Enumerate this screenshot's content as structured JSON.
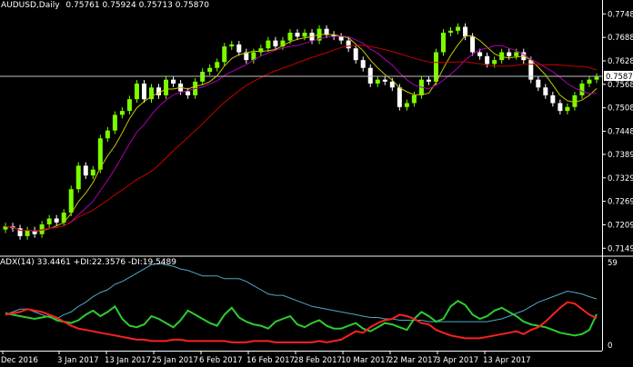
{
  "main": {
    "header": {
      "symbol_label": "AUDUSD,Daily",
      "ohlc": [
        "0.75761",
        "0.75924",
        "0.75713",
        "0.75870"
      ]
    },
    "current_price_label": "0.75870",
    "price_ticks": [
      "0.77480",
      "0.76880",
      "0.76280",
      "0.75680",
      "0.75080",
      "0.74480",
      "0.73890",
      "0.73290",
      "0.72690",
      "0.72090",
      "0.71490"
    ]
  },
  "indicator": {
    "header": "ADX(14) 33.4461 +DI:22.3576 -DI:19.5489",
    "top_tick": "59",
    "bottom_tick": "0"
  },
  "x_axis": {
    "date_labels": [
      "Dec 2016",
      "3 Jan 2017",
      "13 Jan 2017",
      "25 Jan 2017",
      "6 Feb 2017",
      "16 Feb 2017",
      "28 Feb 2017",
      "10 Mar 2017",
      "22 Mar 2017",
      "3 Apr 2017",
      "13 Apr 2017"
    ]
  },
  "colors": {
    "background": "#000000",
    "bull_candle": "#7CFC00",
    "bear_candle": "#FFFFFF",
    "ma_fast": "#C8C800",
    "ma_mid": "#B000B0",
    "ma_slow": "#C80000",
    "adx": "#4FA8C8",
    "plus_di": "#2ECC2E",
    "minus_di": "#FF2020",
    "grid_text": "#FFFFFF",
    "current_price_line": "#C0C0C0"
  },
  "chart_data": [
    {
      "type": "candlestick",
      "title": "AUDUSD,Daily",
      "ylim": [
        0.7145,
        0.7765
      ],
      "dates": [
        "2016-12-22",
        "2016-12-23",
        "2016-12-26",
        "2016-12-27",
        "2016-12-28",
        "2016-12-29",
        "2016-12-30",
        "2017-01-02",
        "2017-01-03",
        "2017-01-04",
        "2017-01-05",
        "2017-01-06",
        "2017-01-09",
        "2017-01-10",
        "2017-01-11",
        "2017-01-12",
        "2017-01-13",
        "2017-01-16",
        "2017-01-17",
        "2017-01-18",
        "2017-01-19",
        "2017-01-20",
        "2017-01-23",
        "2017-01-24",
        "2017-01-25",
        "2017-01-26",
        "2017-01-27",
        "2017-01-30",
        "2017-01-31",
        "2017-02-01",
        "2017-02-02",
        "2017-02-03",
        "2017-02-06",
        "2017-02-07",
        "2017-02-08",
        "2017-02-09",
        "2017-02-10",
        "2017-02-13",
        "2017-02-14",
        "2017-02-15",
        "2017-02-16",
        "2017-02-17",
        "2017-02-20",
        "2017-02-21",
        "2017-02-22",
        "2017-02-23",
        "2017-02-24",
        "2017-02-27",
        "2017-02-28",
        "2017-03-01",
        "2017-03-02",
        "2017-03-03",
        "2017-03-06",
        "2017-03-07",
        "2017-03-08",
        "2017-03-09",
        "2017-03-10",
        "2017-03-13",
        "2017-03-14",
        "2017-03-15",
        "2017-03-16",
        "2017-03-17",
        "2017-03-20",
        "2017-03-21",
        "2017-03-22",
        "2017-03-23",
        "2017-03-24",
        "2017-03-27",
        "2017-03-28",
        "2017-03-29",
        "2017-03-30",
        "2017-03-31",
        "2017-04-03",
        "2017-04-04",
        "2017-04-05",
        "2017-04-06",
        "2017-04-07",
        "2017-04-10",
        "2017-04-11",
        "2017-04-12",
        "2017-04-13",
        "2017-04-14"
      ],
      "closes": [
        0.7205,
        0.72,
        0.718,
        0.7195,
        0.7185,
        0.721,
        0.7225,
        0.7215,
        0.724,
        0.73,
        0.736,
        0.7335,
        0.735,
        0.743,
        0.745,
        0.749,
        0.75,
        0.753,
        0.757,
        0.753,
        0.756,
        0.754,
        0.758,
        0.757,
        0.755,
        0.754,
        0.7575,
        0.76,
        0.761,
        0.7625,
        0.7665,
        0.767,
        0.765,
        0.763,
        0.765,
        0.766,
        0.768,
        0.7665,
        0.768,
        0.77,
        0.769,
        0.77,
        0.768,
        0.771,
        0.7695,
        0.769,
        0.768,
        0.766,
        0.763,
        0.761,
        0.757,
        0.758,
        0.7575,
        0.756,
        0.751,
        0.752,
        0.754,
        0.758,
        0.7575,
        0.765,
        0.77,
        0.7705,
        0.7715,
        0.769,
        0.765,
        0.764,
        0.762,
        0.763,
        0.765,
        0.764,
        0.765,
        0.763,
        0.758,
        0.756,
        0.754,
        0.752,
        0.75,
        0.751,
        0.754,
        0.757,
        0.758,
        0.7587
      ],
      "ma_fast_last": 0.758,
      "ma_mid_last": 0.7568,
      "ma_slow_last": 0.7592
    },
    {
      "type": "line",
      "title": "ADX(14) 33.4461 +DI:22.3576 -DI:19.5489",
      "ylim": [
        0,
        59
      ],
      "series": [
        {
          "name": "ADX",
          "values": [
            22,
            24,
            26,
            26,
            24,
            22,
            20,
            19,
            22,
            24,
            28,
            31,
            35,
            38,
            40,
            44,
            46,
            49,
            52,
            55,
            58,
            59,
            58,
            57,
            55,
            54,
            52,
            50,
            50,
            50,
            48,
            48,
            48,
            46,
            43,
            40,
            37,
            36,
            36,
            34,
            32,
            30,
            28,
            27,
            26,
            25,
            24,
            23,
            22,
            21,
            20,
            20,
            19,
            19,
            18,
            18,
            18,
            18,
            17,
            17,
            17,
            17,
            17,
            17,
            17,
            17,
            17,
            18,
            19,
            21,
            23,
            25,
            28,
            31,
            33,
            35,
            37,
            39,
            38,
            37,
            35,
            33.4461
          ]
        },
        {
          "name": "+DI",
          "values": [
            23,
            22,
            21,
            20,
            19,
            20,
            21,
            18,
            17,
            16,
            18,
            22,
            25,
            21,
            24,
            28,
            19,
            14,
            13,
            15,
            21,
            19,
            16,
            13,
            18,
            25,
            22,
            19,
            16,
            14,
            22,
            27,
            20,
            17,
            15,
            14,
            12,
            17,
            19,
            21,
            15,
            13,
            16,
            18,
            14,
            12,
            12,
            14,
            16,
            12,
            10,
            13,
            16,
            15,
            13,
            11,
            19,
            24,
            21,
            17,
            19,
            28,
            32,
            29,
            22,
            19,
            21,
            25,
            27,
            24,
            21,
            17,
            15,
            14,
            13,
            11,
            9,
            8,
            7,
            8,
            11,
            22.3576
          ]
        },
        {
          "name": "-DI",
          "values": [
            22,
            23,
            24,
            26,
            25,
            24,
            22,
            20,
            17,
            14,
            12,
            11,
            10,
            9,
            8,
            7,
            6,
            5,
            4,
            4,
            3,
            3,
            3,
            4,
            4,
            3,
            3,
            3,
            3,
            3,
            3,
            2,
            2,
            2,
            3,
            3,
            3,
            2,
            2,
            2,
            2,
            2,
            2,
            3,
            2,
            3,
            4,
            7,
            10,
            9,
            13,
            16,
            18,
            19,
            22,
            21,
            19,
            16,
            15,
            11,
            9,
            7,
            6,
            5,
            5,
            5,
            6,
            7,
            8,
            9,
            10,
            8,
            11,
            13,
            17,
            22,
            27,
            31,
            30,
            26,
            22,
            19.5489
          ]
        }
      ]
    }
  ]
}
